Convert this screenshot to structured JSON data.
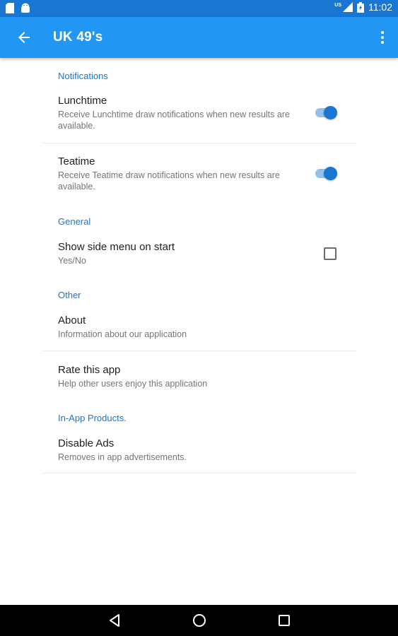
{
  "status_bar": {
    "time": "11:02",
    "network_label": "US",
    "icons": [
      "sd-card-icon",
      "android-icon",
      "signal-icon",
      "battery-icon"
    ]
  },
  "app_bar": {
    "title": "UK 49's",
    "icons": [
      "back-arrow-icon",
      "more-vert-icon"
    ]
  },
  "sections": {
    "notifications": {
      "header": "Notifications",
      "lunchtime": {
        "title": "Lunchtime",
        "summary": "Receive Lunchtime draw notifications when new results are available.",
        "enabled": true
      },
      "teatime": {
        "title": "Teatime",
        "summary": "Receive Teatime draw notifications when new results are available.",
        "enabled": true
      }
    },
    "general": {
      "header": "General",
      "side_menu": {
        "title": "Show side menu on start",
        "summary": "Yes/No",
        "checked": false
      }
    },
    "other": {
      "header": "Other",
      "about": {
        "title": "About",
        "summary": "Information about our application"
      },
      "rate": {
        "title": "Rate this app",
        "summary": "Help other users enjoy this application"
      }
    },
    "in_app": {
      "header": "In-App Products.",
      "disable_ads": {
        "title": "Disable Ads",
        "summary": "Removes in app advertisements."
      }
    }
  },
  "nav_bar": {
    "icons": [
      "back-triangle-icon",
      "home-circle-icon",
      "recents-square-icon"
    ]
  },
  "colors": {
    "status_bar": "#1976d2",
    "app_bar": "#2196f3",
    "accent": "#1976d2",
    "switch_track": "#8ec1ee"
  }
}
